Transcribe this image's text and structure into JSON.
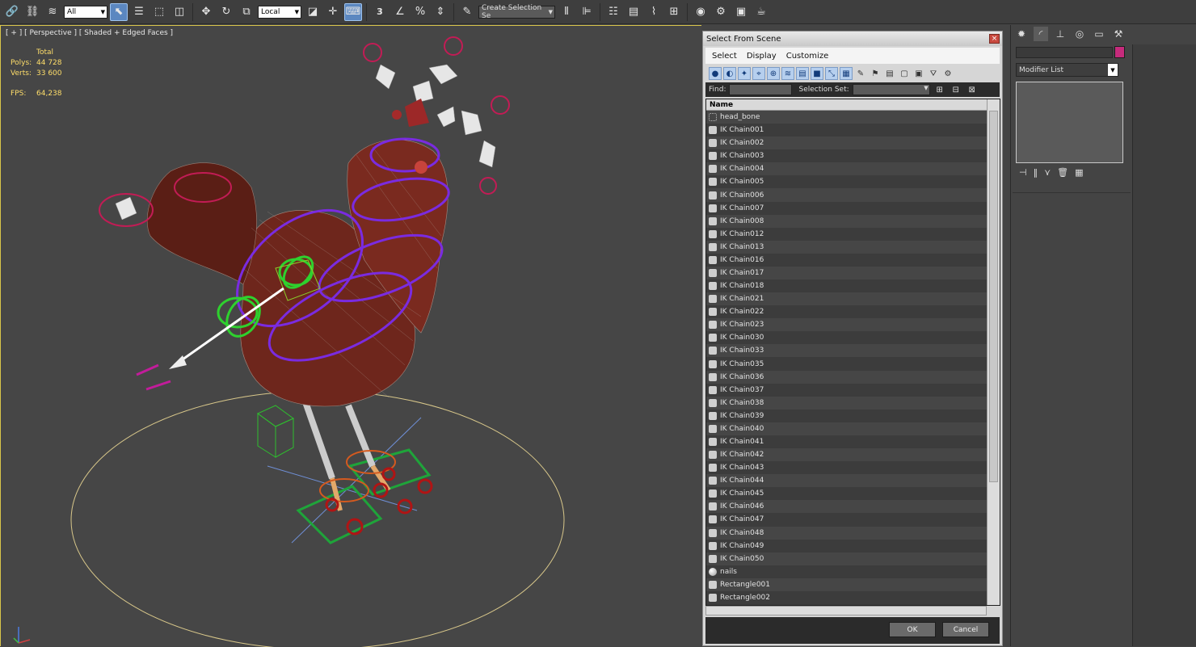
{
  "toolbar": {
    "filter_label": "All",
    "ref_coord_label": "Local",
    "snap_label": "3",
    "named_set_placeholder": "Create Selection Se",
    "icons": [
      "link-icon",
      "unlink-icon",
      "bind-space-warp-icon",
      "select-object-icon",
      "select-by-name-icon",
      "rect-selection-icon",
      "window-crossing-icon",
      "move-icon",
      "rotate-icon",
      "scale-icon",
      "use-pivot-icon",
      "manipulate-icon",
      "keyboard-shortcut-icon",
      "snaps-toggle-icon",
      "angle-snap-icon",
      "percent-snap-icon",
      "spinner-snap-icon",
      "edit-named-sets-icon",
      "mirror-icon",
      "align-icon",
      "layer-manager-icon",
      "ribbon-icon",
      "curve-editor-icon",
      "schematic-view-icon",
      "material-editor-icon",
      "render-setup-icon",
      "rendered-frame-icon",
      "render-icon"
    ]
  },
  "viewport": {
    "label": "[ + ] [ Perspective ] [ Shaded + Edged Faces ]",
    "stats": {
      "header": "Total",
      "polys_label": "Polys:",
      "polys_value": "44 728",
      "verts_label": "Verts:",
      "verts_value": "33 600",
      "fps_label": "FPS:",
      "fps_value": "64,238"
    }
  },
  "dialog": {
    "title": "Select From Scene",
    "close_label": "×",
    "menu": [
      "Select",
      "Display",
      "Customize"
    ],
    "find_label": "Find:",
    "selection_set_label": "Selection Set:",
    "column_header": "Name",
    "items": [
      {
        "name": "head_bone",
        "icon": "bone"
      },
      {
        "name": "IK Chain001",
        "icon": "ik"
      },
      {
        "name": "IK Chain002",
        "icon": "ik"
      },
      {
        "name": "IK Chain003",
        "icon": "ik"
      },
      {
        "name": "IK Chain004",
        "icon": "ik"
      },
      {
        "name": "IK Chain005",
        "icon": "ik"
      },
      {
        "name": "IK Chain006",
        "icon": "ik"
      },
      {
        "name": "IK Chain007",
        "icon": "ik"
      },
      {
        "name": "IK Chain008",
        "icon": "ik"
      },
      {
        "name": "IK Chain012",
        "icon": "ik"
      },
      {
        "name": "IK Chain013",
        "icon": "ik"
      },
      {
        "name": "IK Chain016",
        "icon": "ik"
      },
      {
        "name": "IK Chain017",
        "icon": "ik"
      },
      {
        "name": "IK Chain018",
        "icon": "ik"
      },
      {
        "name": "IK Chain021",
        "icon": "ik"
      },
      {
        "name": "IK Chain022",
        "icon": "ik"
      },
      {
        "name": "IK Chain023",
        "icon": "ik"
      },
      {
        "name": "IK Chain030",
        "icon": "ik"
      },
      {
        "name": "IK Chain033",
        "icon": "ik"
      },
      {
        "name": "IK Chain035",
        "icon": "ik"
      },
      {
        "name": "IK Chain036",
        "icon": "ik"
      },
      {
        "name": "IK Chain037",
        "icon": "ik"
      },
      {
        "name": "IK Chain038",
        "icon": "ik"
      },
      {
        "name": "IK Chain039",
        "icon": "ik"
      },
      {
        "name": "IK Chain040",
        "icon": "ik"
      },
      {
        "name": "IK Chain041",
        "icon": "ik"
      },
      {
        "name": "IK Chain042",
        "icon": "ik"
      },
      {
        "name": "IK Chain043",
        "icon": "ik"
      },
      {
        "name": "IK Chain044",
        "icon": "ik"
      },
      {
        "name": "IK Chain045",
        "icon": "ik"
      },
      {
        "name": "IK Chain046",
        "icon": "ik"
      },
      {
        "name": "IK Chain047",
        "icon": "ik"
      },
      {
        "name": "IK Chain048",
        "icon": "ik"
      },
      {
        "name": "IK Chain049",
        "icon": "ik"
      },
      {
        "name": "IK Chain050",
        "icon": "ik"
      },
      {
        "name": "nails",
        "icon": "sphere"
      },
      {
        "name": "Rectangle001",
        "icon": "shape"
      },
      {
        "name": "Rectangle002",
        "icon": "shape"
      }
    ],
    "ok_label": "OK",
    "cancel_label": "Cancel"
  },
  "command_panel": {
    "tabs": [
      "create-tab-icon",
      "modify-tab-icon",
      "hierarchy-tab-icon",
      "motion-tab-icon",
      "display-tab-icon",
      "utilities-tab-icon"
    ],
    "modifier_list_label": "Modifier List",
    "object_color": "#c62b7c"
  }
}
